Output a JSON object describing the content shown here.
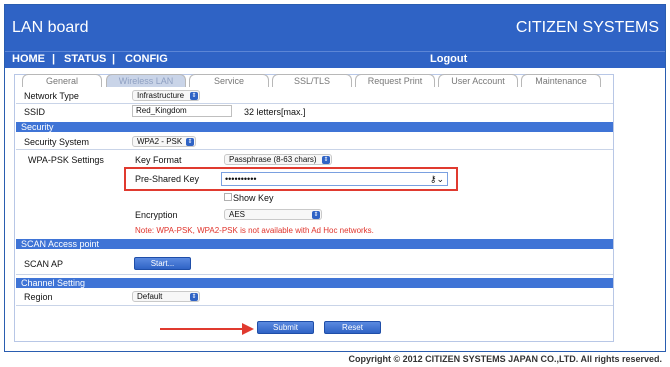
{
  "header": {
    "title": "LAN board",
    "brand": "CITIZEN SYSTEMS"
  },
  "nav": {
    "home": "HOME",
    "status": "STATUS",
    "config": "CONFIG",
    "logout": "Logout",
    "separator": "|"
  },
  "tabs": [
    "General",
    "Wireless LAN",
    "Service",
    "SSL/TLS",
    "Request Print",
    "User Account",
    "Maintenance"
  ],
  "active_tab": "Wireless LAN",
  "network": {
    "network_type_label": "Network Type",
    "network_type_value": "Infrastructure",
    "ssid_label": "SSID",
    "ssid_value": "Red_Kingdom",
    "ssid_hint": "32 letters[max.]"
  },
  "security": {
    "section_title": "Security",
    "security_system_label": "Security System",
    "security_system_value": "WPA2 - PSK",
    "wpa_settings_label": "WPA-PSK Settings",
    "key_format_label": "Key Format",
    "key_format_value": "Passphrase (8-63 chars)",
    "psk_label": "Pre-Shared Key",
    "psk_value": "••••••••••",
    "show_key_label": "Show Key",
    "encryption_label": "Encryption",
    "encryption_value": "AES",
    "note": "Note: WPA-PSK, WPA2-PSK is not available with Ad Hoc networks."
  },
  "scan": {
    "section_title": "SCAN Access point",
    "label": "SCAN AP",
    "button": "Start..."
  },
  "channel": {
    "section_title": "Channel Setting",
    "region_label": "Region",
    "region_value": "Default"
  },
  "actions": {
    "submit": "Submit",
    "reset": "Reset"
  },
  "footer": {
    "copyright": "Copyright © 2012 CITIZEN SYSTEMS JAPAN CO.,LTD. All rights reserved."
  },
  "colors": {
    "primary": "#2f63c5",
    "section": "#3f74d6",
    "highlight": "#e03a2f"
  },
  "icons": {
    "key": "key-icon",
    "chevron": "chevron-updown-icon",
    "arrow": "red-arrow-icon"
  }
}
